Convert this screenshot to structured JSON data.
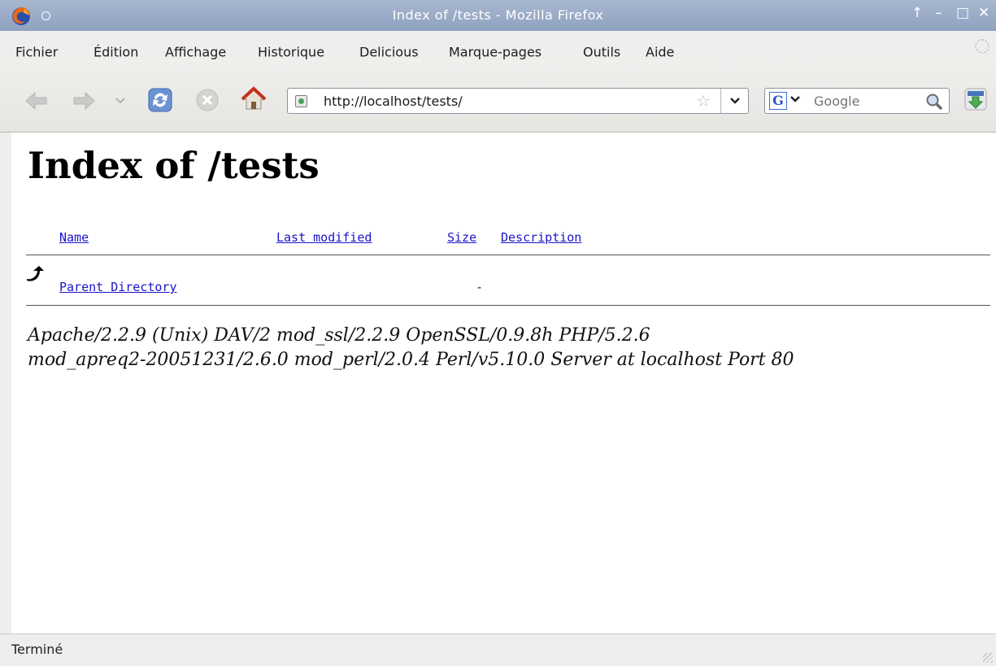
{
  "window": {
    "title": "Index of /tests - Mozilla Firefox",
    "controls": {
      "up": "↑",
      "minimize": "–",
      "maximize": "□",
      "close": "✕"
    }
  },
  "menu": {
    "items": [
      "Fichier",
      "Édition",
      "Affichage",
      "Historique",
      "Delicious",
      "Marque-pages",
      "Outils",
      "Aide"
    ]
  },
  "toolbar": {
    "url": "http://localhost/tests/",
    "search_placeholder": "Google",
    "search_engine_letter": "G"
  },
  "page": {
    "heading": "Index of /tests",
    "columns": [
      "Name",
      "Last modified",
      "Size",
      "Description"
    ],
    "rows": [
      {
        "name": "Parent Directory",
        "last_modified": "",
        "size": "-",
        "description": ""
      }
    ],
    "address_line1": "Apache/2.2.9 (Unix) DAV/2 mod_ssl/2.2.9 OpenSSL/0.9.8h PHP/5.2.6",
    "address_line2": "mod_apreq2-20051231/2.6.0 mod_perl/2.0.4 Perl/v5.10.0 Server at localhost Port 80"
  },
  "status": {
    "text": "Terminé"
  },
  "colors": {
    "link": "#1a14c8",
    "titlebar": "#8ea1c0"
  },
  "icons": [
    "firefox-logo-icon",
    "back-icon",
    "forward-icon",
    "history-dropdown-icon",
    "reload-icon",
    "stop-icon",
    "home-icon",
    "site-identity-icon",
    "bookmark-star-icon",
    "search-engine-icon",
    "magnifier-icon",
    "download-icon",
    "parent-directory-icon",
    "throbber-icon"
  ]
}
